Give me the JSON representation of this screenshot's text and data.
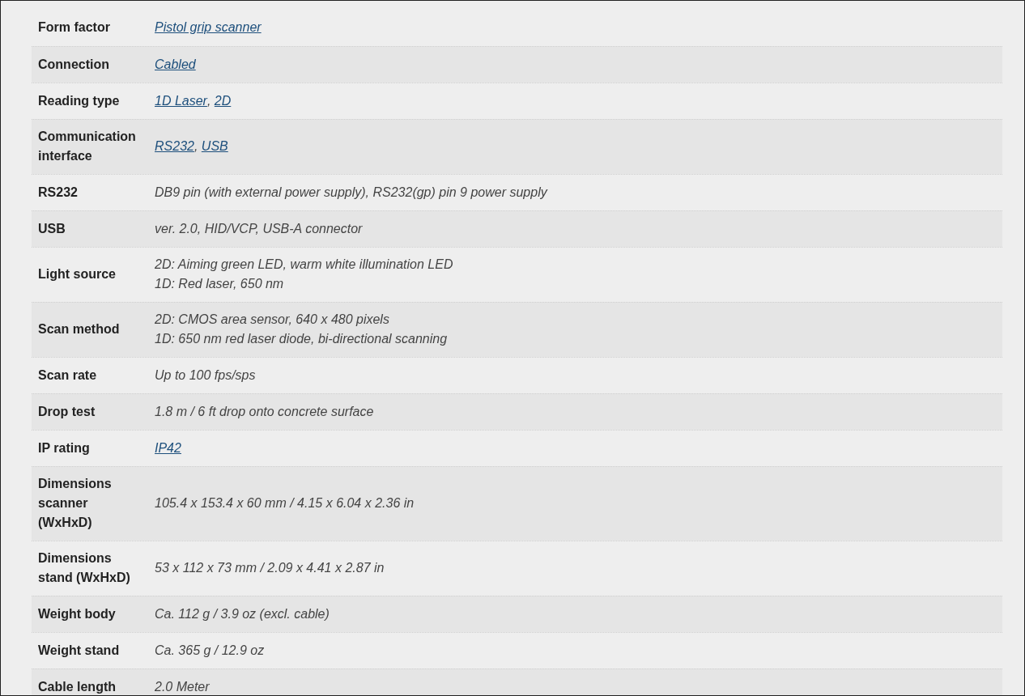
{
  "specs": [
    {
      "label": "Form factor",
      "lines": [
        [
          {
            "kind": "link",
            "text": "Pistol grip scanner"
          }
        ]
      ]
    },
    {
      "label": "Connection",
      "lines": [
        [
          {
            "kind": "link",
            "text": "Cabled"
          }
        ]
      ]
    },
    {
      "label": "Reading type",
      "lines": [
        [
          {
            "kind": "link",
            "text": "1D Laser"
          },
          {
            "kind": "text",
            "text": ","
          },
          {
            "kind": "link",
            "text": "2D"
          }
        ]
      ]
    },
    {
      "label": "Communication interface",
      "lines": [
        [
          {
            "kind": "link",
            "text": "RS232"
          },
          {
            "kind": "text",
            "text": ","
          },
          {
            "kind": "link",
            "text": "USB"
          }
        ]
      ]
    },
    {
      "label": "RS232",
      "lines": [
        [
          {
            "kind": "text",
            "text": "DB9 pin (with external power supply), RS232(gp) pin 9 power supply"
          }
        ]
      ]
    },
    {
      "label": "USB",
      "lines": [
        [
          {
            "kind": "text",
            "text": "ver. 2.0, HID/VCP, USB-A connector"
          }
        ]
      ]
    },
    {
      "label": "Light source",
      "lines": [
        [
          {
            "kind": "text",
            "text": "2D: Aiming green LED, warm white illumination LED"
          }
        ],
        [
          {
            "kind": "text",
            "text": "1D: Red laser, 650 nm"
          }
        ]
      ]
    },
    {
      "label": "Scan method",
      "lines": [
        [
          {
            "kind": "text",
            "text": "2D: CMOS area sensor, 640 x 480 pixels"
          }
        ],
        [
          {
            "kind": "text",
            "text": "1D: 650 nm red laser diode, bi-directional scanning"
          }
        ]
      ]
    },
    {
      "label": "Scan rate",
      "lines": [
        [
          {
            "kind": "text",
            "text": "Up to 100 fps/sps"
          }
        ]
      ]
    },
    {
      "label": "Drop test",
      "lines": [
        [
          {
            "kind": "text",
            "text": "1.8 m / 6 ft drop onto concrete surface"
          }
        ]
      ]
    },
    {
      "label": "IP rating",
      "lines": [
        [
          {
            "kind": "link",
            "text": "IP42"
          }
        ]
      ]
    },
    {
      "label": "Dimensions scanner (WxHxD)",
      "lines": [
        [
          {
            "kind": "text",
            "text": "105.4 x 153.4 x 60 mm / 4.15 x 6.04 x 2.36 in"
          }
        ]
      ]
    },
    {
      "label": "Dimensions stand (WxHxD)",
      "lines": [
        [
          {
            "kind": "text",
            "text": "53 x 112 x 73 mm / 2.09 x 4.41 x 2.87 in"
          }
        ]
      ]
    },
    {
      "label": "Weight body",
      "lines": [
        [
          {
            "kind": "text",
            "text": "Ca. 112 g / 3.9 oz (excl. cable)"
          }
        ]
      ]
    },
    {
      "label": "Weight stand",
      "lines": [
        [
          {
            "kind": "text",
            "text": "Ca. 365 g / 12.9 oz"
          }
        ]
      ]
    },
    {
      "label": "Cable length",
      "lines": [
        [
          {
            "kind": "text",
            "text": "2.0 Meter"
          }
        ]
      ]
    }
  ]
}
